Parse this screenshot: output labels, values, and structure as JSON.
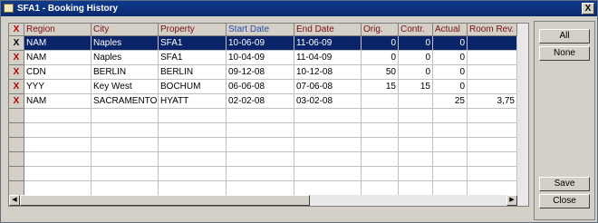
{
  "window": {
    "title": "SFA1 - Booking History",
    "close_glyph": "X"
  },
  "table": {
    "mark_header": "X",
    "headers": [
      "Region",
      "City",
      "Property",
      "Start Date",
      "End Date",
      "Orig.",
      "Contr.",
      "Actual",
      "Room Rev."
    ],
    "sorted_column": "Start Date",
    "rows": [
      {
        "mark": "X",
        "cells": [
          "NAM",
          "Naples",
          "SFA1",
          "10-06-09",
          "11-06-09",
          "0",
          "0",
          "0",
          ""
        ],
        "selected": true
      },
      {
        "mark": "X",
        "cells": [
          "NAM",
          "Naples",
          "SFA1",
          "10-04-09",
          "11-04-09",
          "0",
          "0",
          "0",
          ""
        ]
      },
      {
        "mark": "X",
        "cells": [
          "CDN",
          "BERLIN",
          "BERLIN",
          "09-12-08",
          "10-12-08",
          "50",
          "0",
          "0",
          ""
        ]
      },
      {
        "mark": "X",
        "cells": [
          "YYY",
          "Key West",
          "BOCHUM",
          "06-06-08",
          "07-06-08",
          "15",
          "15",
          "0",
          ""
        ]
      },
      {
        "mark": "X",
        "cells": [
          "NAM",
          "SACRAMENTO",
          "HYATT",
          "02-02-08",
          "03-02-08",
          "",
          "",
          "25",
          "3,75"
        ]
      }
    ]
  },
  "buttons": {
    "all": "All",
    "none": "None",
    "save": "Save",
    "close": "Close"
  },
  "colors": {
    "selection": "#0a246a",
    "header_text": "#7a1010",
    "sorted_header": "#2a4ea8",
    "mark": "#b00000"
  }
}
